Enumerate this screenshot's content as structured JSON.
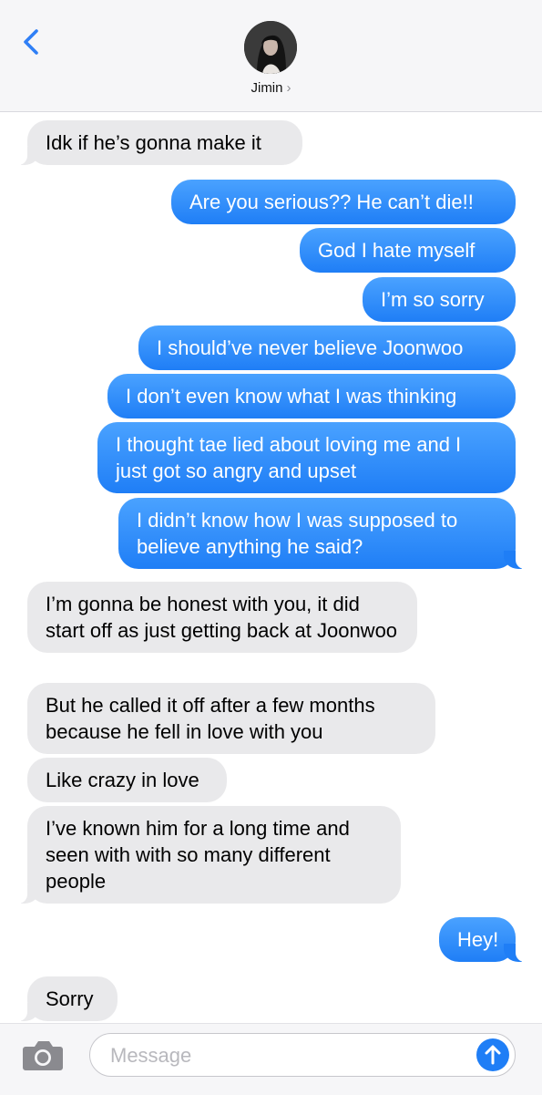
{
  "header": {
    "contact_name": "Jimin",
    "chevron": "›"
  },
  "messages": [
    {
      "dir": "in",
      "text": "Idk if he’s gonna make it"
    },
    {
      "dir": "out",
      "text": "Are you serious?? He can’t die!!"
    },
    {
      "dir": "out",
      "text": "God I hate myself"
    },
    {
      "dir": "out",
      "text": "I’m so sorry"
    },
    {
      "dir": "out",
      "text": "I should’ve never believe Joonwoo"
    },
    {
      "dir": "out",
      "text": "I don’t even know what I was thinking"
    },
    {
      "dir": "out",
      "text": "I thought tae lied about loving me and I just got so angry and upset"
    },
    {
      "dir": "out",
      "text": "I didn’t know how I was supposed to believe anything he said?"
    },
    {
      "dir": "in",
      "text": "I’m gonna be honest with you, it did start off as just getting back at Joonwoo"
    },
    {
      "dir": "in",
      "text": "But he called it off after a few months because he fell in love with you"
    },
    {
      "dir": "in",
      "text": "Like crazy in love"
    },
    {
      "dir": "in",
      "text": "I’ve known him for a long time and seen with with so many different people"
    },
    {
      "dir": "out",
      "text": "Hey!"
    },
    {
      "dir": "in",
      "text": "Sorry"
    }
  ],
  "composer": {
    "placeholder": "Message",
    "value": ""
  },
  "icons": {
    "back": "back-chevron-icon",
    "camera": "camera-icon",
    "send": "send-arrow-icon"
  },
  "colors": {
    "accent": "#1f7ef6",
    "incoming_bubble": "#e9e9eb",
    "header_bg": "#f6f6f8"
  }
}
